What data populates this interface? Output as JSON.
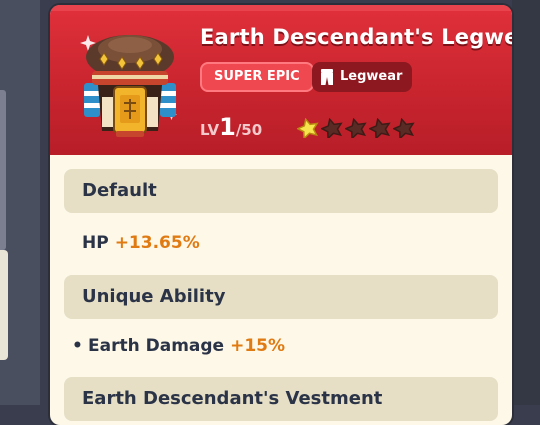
{
  "item": {
    "name": "Earth Descendant's Legwear",
    "rarity": "SUPER EPIC",
    "type": "Legwear",
    "level_prefix": "LV",
    "level_current": "1",
    "level_max": "/50",
    "stars_filled": 1,
    "stars_total": 5
  },
  "sections": {
    "default_title": "Default",
    "hp_label": "HP",
    "hp_value": "+13.65%",
    "unique_title": "Unique Ability",
    "bullet": "•",
    "earth_label": "Earth Damage",
    "earth_value": "+15%",
    "set_title": "Earth Descendant's Vestment"
  },
  "colors": {
    "header_red": "#c7242e",
    "rarity_pink": "#f04850",
    "value_orange": "#e07a12",
    "section_bg": "#e6dfc6",
    "card_bg": "#fdf8e8"
  },
  "icons": {
    "item": "legwear-armor-icon",
    "type": "pants-icon",
    "star": "star-icon"
  }
}
